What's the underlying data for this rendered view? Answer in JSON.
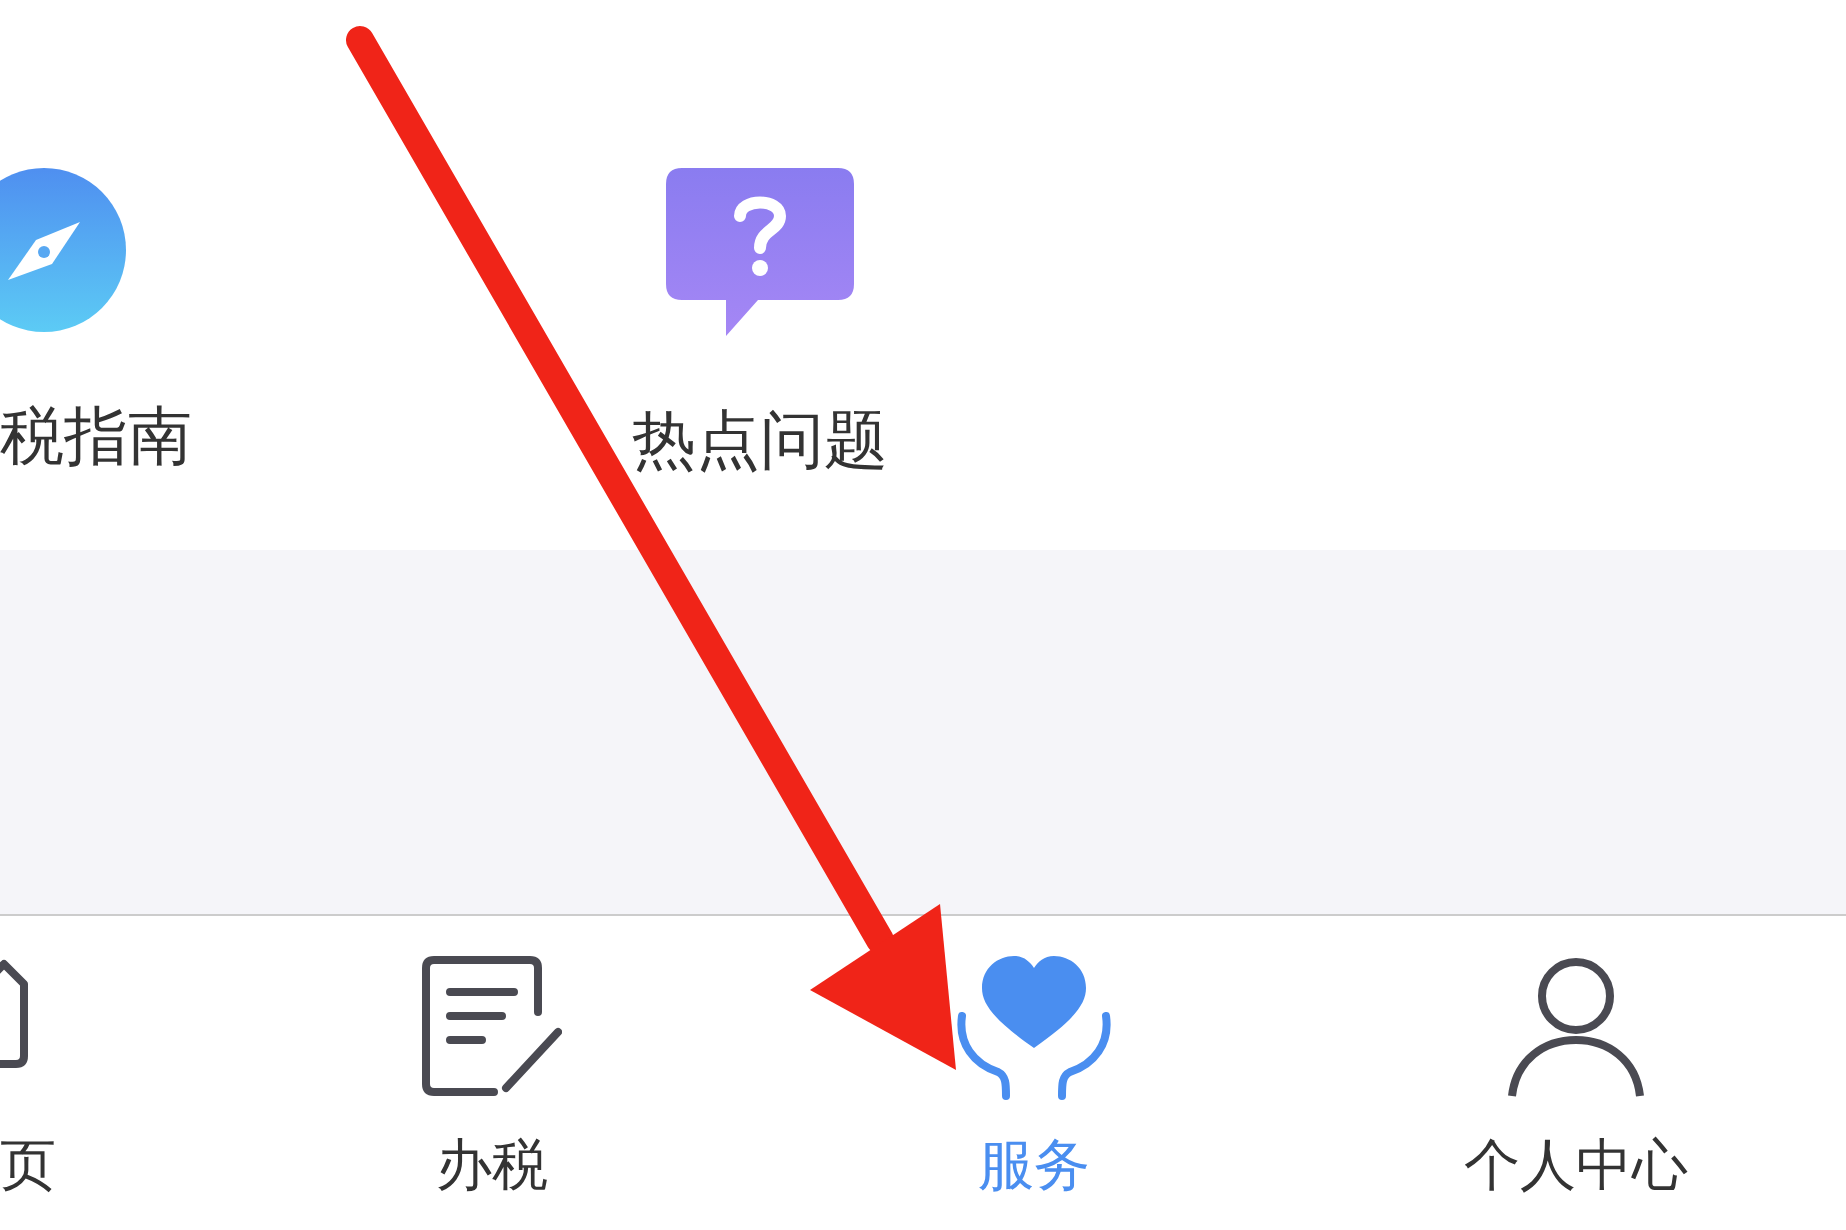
{
  "shortcuts": [
    {
      "kind": "compass",
      "label": "税指南"
    },
    {
      "kind": "question",
      "label": "热点问题"
    }
  ],
  "tab_bar": [
    {
      "kind": "home",
      "label": "页",
      "selected": false
    },
    {
      "kind": "edit",
      "label": "办税",
      "selected": false
    },
    {
      "kind": "heart",
      "label": "服务",
      "selected": true
    },
    {
      "kind": "person",
      "label": "个人中心",
      "selected": false
    }
  ]
}
